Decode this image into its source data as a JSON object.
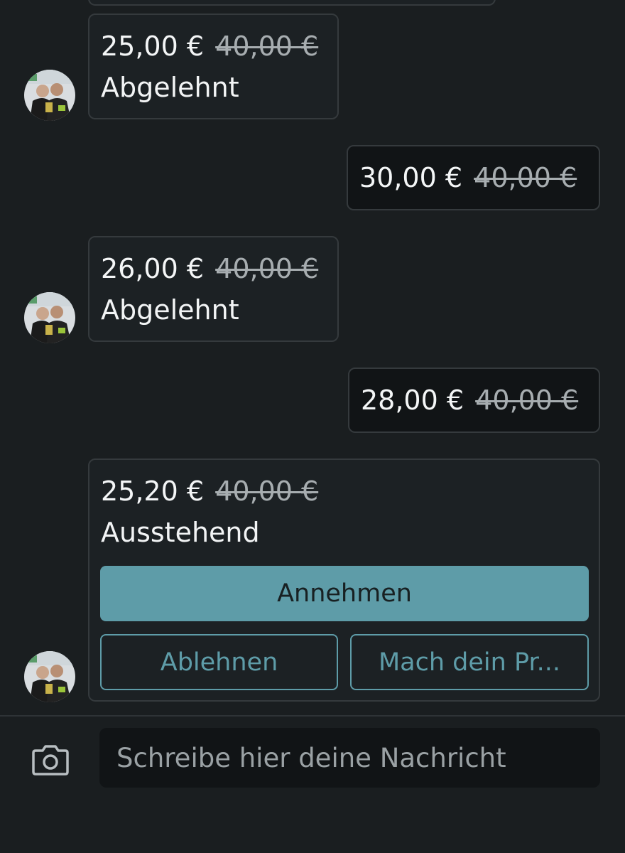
{
  "messages": [
    {
      "price": "25,00 €",
      "original_price": "40,00 €",
      "status": "Abgelehnt"
    },
    {
      "price": "30,00 €",
      "original_price": "40,00 €"
    },
    {
      "price": "26,00 €",
      "original_price": "40,00 €",
      "status": "Abgelehnt"
    },
    {
      "price": "28,00 €",
      "original_price": "40,00 €"
    },
    {
      "price": "25,20 €",
      "original_price": "40,00 €",
      "status": "Ausstehend"
    }
  ],
  "actions": {
    "accept": "Annehmen",
    "decline": "Ablehnen",
    "counter": "Mach dein Pr..."
  },
  "composer": {
    "placeholder": "Schreibe hier deine Nachricht",
    "camera_icon": "camera-icon"
  },
  "colors": {
    "background": "#1a1e20",
    "accent": "#5e9ca8",
    "strike_text": "#a7adb0"
  }
}
